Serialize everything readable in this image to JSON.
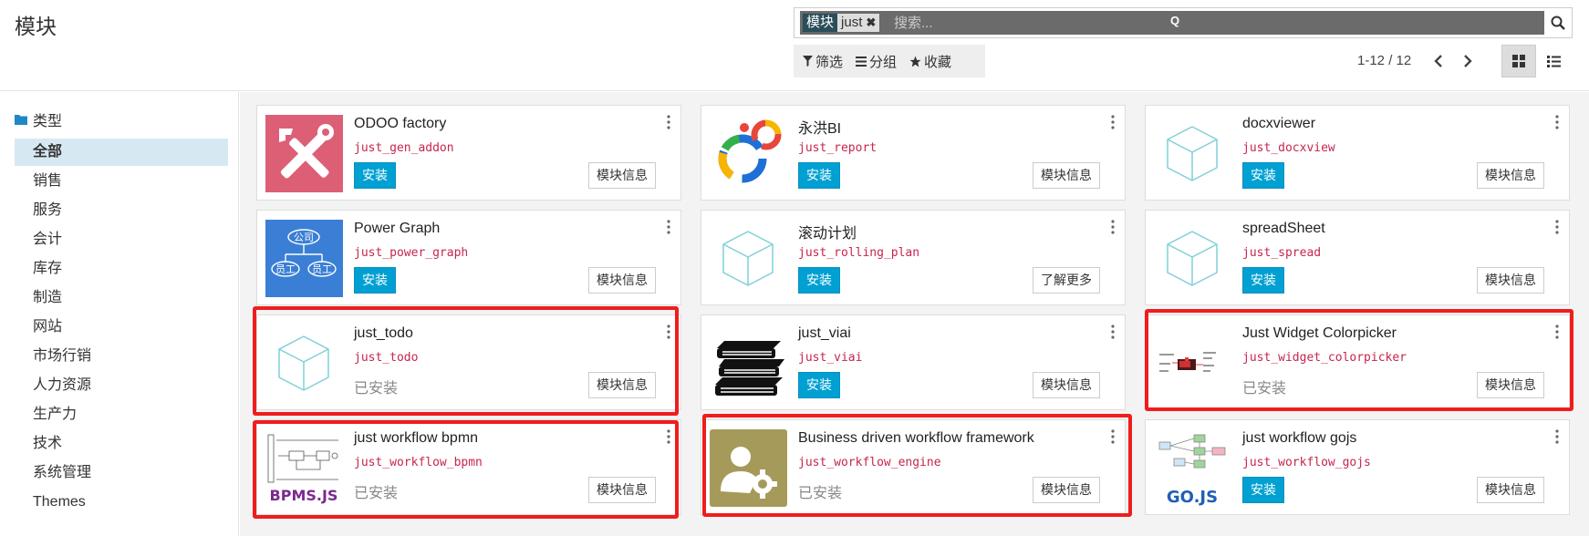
{
  "header": {
    "title": "模块",
    "search": {
      "facet_name": "模块",
      "facet_value": "just",
      "placeholder": "搜索...",
      "q": "Q"
    },
    "filters": [
      {
        "label": "筛选",
        "icon": "filter-icon"
      },
      {
        "label": "分组",
        "icon": "bars-icon"
      },
      {
        "label": "收藏",
        "icon": "star-icon"
      }
    ],
    "pager": "1-12 / 12"
  },
  "sidebar": {
    "header": "类型",
    "items": [
      "全部",
      "销售",
      "服务",
      "会计",
      "库存",
      "制造",
      "网站",
      "市场行销",
      "人力资源",
      "生产力",
      "技术",
      "系统管理",
      "Themes"
    ]
  },
  "cards": [
    {
      "name": "ODOO factory",
      "tech": "just_gen_addon",
      "status": "安装",
      "installed": false,
      "action": "模块信息",
      "icon": "tools-icon"
    },
    {
      "name": "永洪BI",
      "tech": "just_report",
      "status": "安装",
      "installed": false,
      "action": "模块信息",
      "icon": "rings-logo-icon"
    },
    {
      "name": "docxviewer",
      "tech": "just_docxview",
      "status": "安装",
      "installed": false,
      "action": "模块信息",
      "icon": "cube-icon"
    },
    {
      "name": "Power Graph",
      "tech": "just_power_graph",
      "status": "安装",
      "installed": false,
      "action": "模块信息",
      "icon": "org-chart-icon",
      "icon_texts": [
        "公司",
        "员工",
        "员工"
      ]
    },
    {
      "name": "滚动计划",
      "tech": "just_rolling_plan",
      "status": "安装",
      "installed": false,
      "action": "了解更多",
      "icon": "cube-icon"
    },
    {
      "name": "spreadSheet",
      "tech": "just_spread",
      "status": "安装",
      "installed": false,
      "action": "模块信息",
      "icon": "cube-icon"
    },
    {
      "name": "just_todo",
      "tech": "just_todo",
      "status": "已安装",
      "installed": true,
      "action": "模块信息",
      "icon": "cube-icon"
    },
    {
      "name": "just_viai",
      "tech": "just_viai",
      "status": "安装",
      "installed": false,
      "action": "模块信息",
      "icon": "books-icon"
    },
    {
      "name": "Just Widget Colorpicker",
      "tech": "just_widget_colorpicker",
      "status": "已安装",
      "installed": true,
      "action": "模块信息",
      "icon": "colorpicker-screenshot-icon"
    },
    {
      "name": "just workflow bpmn",
      "tech": "just_workflow_bpmn",
      "status": "已安装",
      "installed": true,
      "action": "模块信息",
      "icon": "bpmn-logo-icon",
      "icon_label": "BPMS.JS"
    },
    {
      "name": "Business driven workflow framework",
      "tech": "just_workflow_engine",
      "status": "已安装",
      "installed": true,
      "action": "模块信息",
      "icon": "user-gear-icon"
    },
    {
      "name": "just workflow gojs",
      "tech": "just_workflow_gojs",
      "status": "安装",
      "installed": false,
      "action": "模块信息",
      "icon": "gojs-logo-icon",
      "icon_label": "GO.JS"
    }
  ],
  "colors": {
    "install_button": "#00a0d2",
    "technical_name": "#c7254e",
    "highlight": "#ef1d1d",
    "sidebar_active": "#d6e9f3"
  }
}
